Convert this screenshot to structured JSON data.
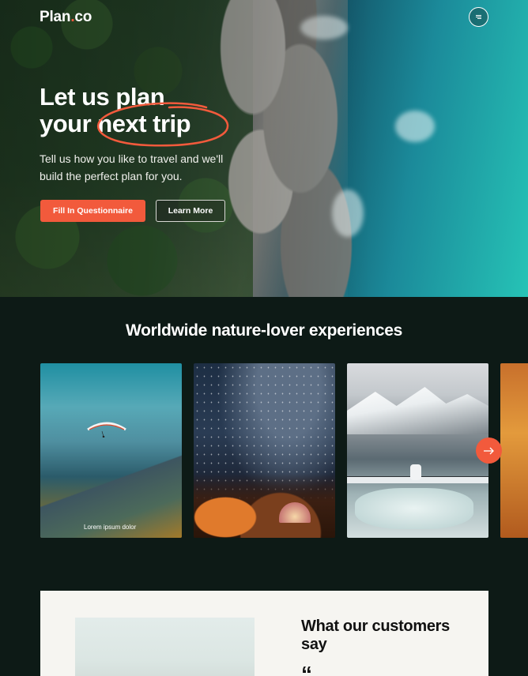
{
  "brand": {
    "logo_prefix": "Plan",
    "logo_dot": ".",
    "logo_suffix": "co",
    "accent": "#f25a3c"
  },
  "header": {
    "menu_icon": "menu-icon"
  },
  "hero": {
    "headline_line1": "Let us plan",
    "headline_line2": "your next trip",
    "subtext": "Tell us how you like to travel and we'll build the perfect plan for you.",
    "primary_button": "Fill In Questionnaire",
    "secondary_button": "Learn More"
  },
  "experiences": {
    "title": "Worldwide nature-lover experiences",
    "cards": [
      {
        "caption": "Lorem ipsum dolor"
      },
      {
        "caption": ""
      },
      {
        "caption": ""
      },
      {
        "caption": ""
      }
    ],
    "next_icon": "arrow-right-icon"
  },
  "testimonial": {
    "title": "What our customers say",
    "quote_mark": "“"
  }
}
